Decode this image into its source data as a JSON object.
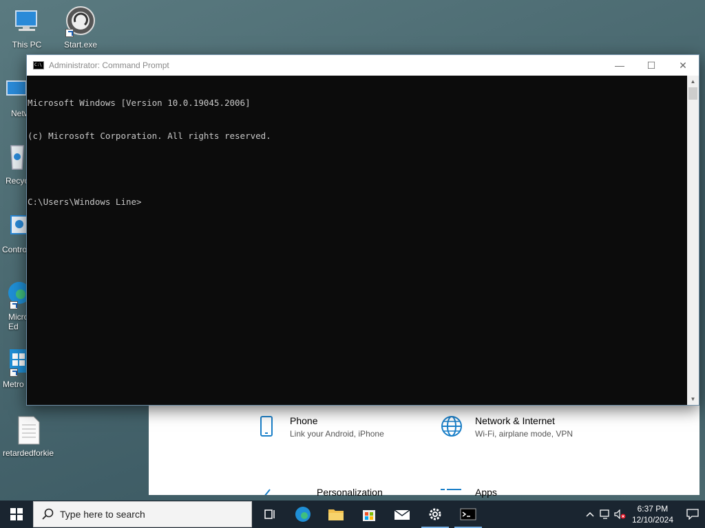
{
  "desktop": {
    "icons": [
      {
        "label": "This PC",
        "icon": "computer-icon"
      },
      {
        "label": "Start.exe",
        "icon": "disc-icon"
      },
      {
        "label": "Netw",
        "icon": "network-icon"
      },
      {
        "label": "Recyc",
        "icon": "recycle-bin-icon"
      },
      {
        "label": "Contro",
        "icon": "control-panel-icon"
      },
      {
        "label": "Micro\nEd",
        "icon": "edge-icon"
      },
      {
        "label": "Metro",
        "icon": "metro-icon"
      },
      {
        "label": "retardedforkie",
        "icon": "text-file-icon"
      }
    ]
  },
  "cmd": {
    "title": "Administrator: Command Prompt",
    "lines": [
      "Microsoft Windows [Version 10.0.19045.2006]",
      "(c) Microsoft Corporation. All rights reserved.",
      "",
      "C:\\Users\\Windows Line>"
    ],
    "minimize": "—",
    "maximize": "☐",
    "close": "✕"
  },
  "settings": {
    "items": [
      {
        "title": "Phone",
        "subtitle": "Link your Android, iPhone",
        "icon": "phone-icon"
      },
      {
        "title": "Network & Internet",
        "subtitle": "Wi-Fi, airplane mode, VPN",
        "icon": "globe-icon"
      },
      {
        "title": "Personalization",
        "subtitle": "",
        "icon": "paintbrush-icon"
      },
      {
        "title": "Apps",
        "subtitle": "",
        "icon": "apps-icon"
      }
    ]
  },
  "taskbar": {
    "search_placeholder": "Type here to search",
    "apps": [
      "task-view-icon",
      "edge-icon",
      "file-explorer-icon",
      "store-icon",
      "mail-icon",
      "settings-icon",
      "cmd-icon"
    ],
    "time": "6:37 PM",
    "date": "12/10/2024"
  },
  "colors": {
    "taskbar": "#1a2530",
    "accent": "#0078d4",
    "console_text": "#c8c8c8"
  }
}
